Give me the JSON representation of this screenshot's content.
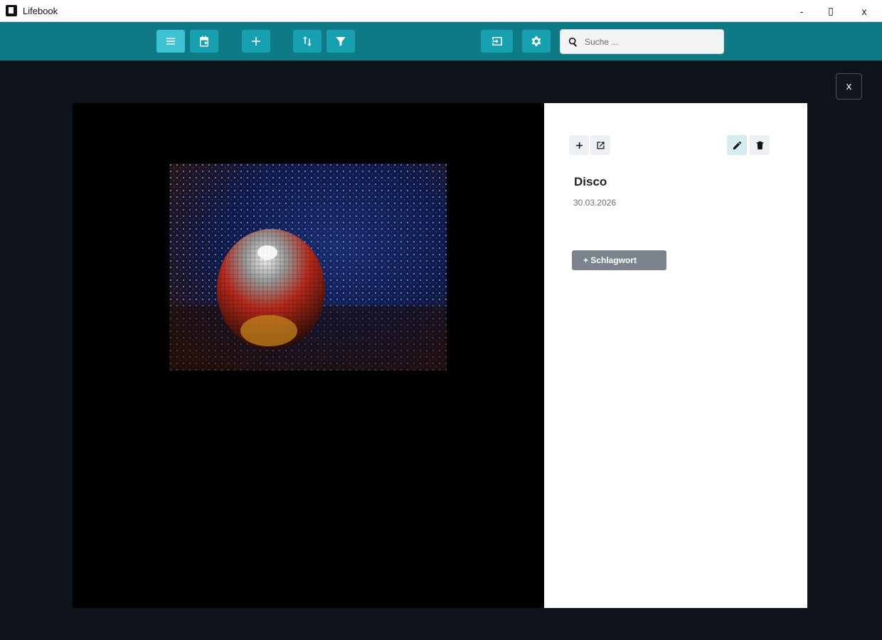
{
  "window": {
    "title": "Lifebook",
    "minimize": "-",
    "maximize": "▯",
    "close": "x"
  },
  "toolbar": {
    "buttons": [
      {
        "icon": "list-icon",
        "active": true
      },
      {
        "icon": "calendar-icon",
        "active": false
      },
      {
        "icon": "plus-icon",
        "active": false
      },
      {
        "icon": "sort-icon",
        "active": false
      },
      {
        "icon": "filter-icon",
        "active": false
      },
      {
        "icon": "import-icon",
        "active": false
      },
      {
        "icon": "gear-icon",
        "active": false
      }
    ],
    "search": {
      "placeholder": "Suche ...",
      "value": ""
    }
  },
  "overlay": {
    "close_label": "x"
  },
  "entry": {
    "title": "Disco",
    "date": "30.03.2026",
    "tag_button": "+ Schlagwort",
    "actions": [
      "plus-icon",
      "open-external-icon",
      "pencil-icon",
      "trash-icon"
    ]
  },
  "colors": {
    "toolbar": "#0e7a86",
    "toolbar_button": "#17a0b0",
    "toolbar_button_active": "#3ec3d4",
    "background": "#0f141b",
    "tag_button": "#7b848c"
  }
}
